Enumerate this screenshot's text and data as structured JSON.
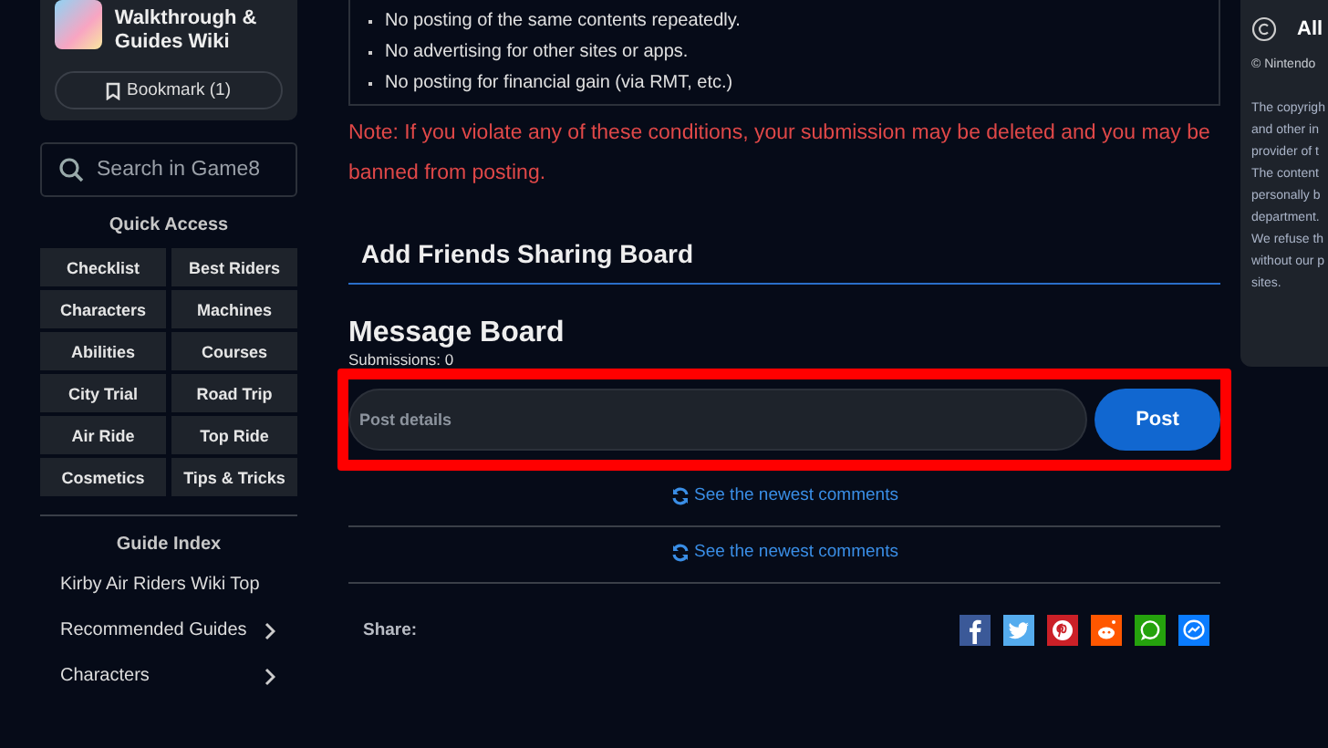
{
  "sidebar": {
    "wiki_title": "Walkthrough & Guides Wiki",
    "bookmark": "Bookmark (1)",
    "search": {
      "placeholder": "Search in Game8"
    },
    "quick_access": {
      "heading": "Quick Access",
      "links": [
        "Checklist",
        "Best Riders",
        "Characters",
        "Machines",
        "Abilities",
        "Courses",
        "City Trial",
        "Road Trip",
        "Air Ride",
        "Top Ride",
        "Cosmetics",
        "Tips & Tricks"
      ]
    },
    "guide_index": {
      "heading": "Guide Index",
      "items": [
        {
          "label": "Kirby Air Riders Wiki Top",
          "has_submenu": false
        },
        {
          "label": "Recommended Guides",
          "has_submenu": true
        },
        {
          "label": "Characters",
          "has_submenu": true
        }
      ]
    }
  },
  "main": {
    "rules": [
      "No posting of the same contents repeatedly.",
      "No advertising for other sites or apps.",
      "No posting for financial gain (via RMT, etc.)"
    ],
    "note": "Note: If you violate any of these conditions, your submission may be deleted and you may be banned from posting.",
    "section_heading": "Add Friends Sharing Board",
    "board_title": "Message Board",
    "submissions": "Submissions: 0",
    "composer": {
      "highlighted": true,
      "placeholder": "Post details",
      "button": "Post"
    },
    "newest_links": [
      "See the newest comments",
      "See the newest comments"
    ],
    "share": {
      "label": "Share:",
      "networks": [
        {
          "kind": "facebook",
          "color": "#3b5998"
        },
        {
          "kind": "twitter",
          "color": "#55acee"
        },
        {
          "kind": "pinterest",
          "color": "#cb2027"
        },
        {
          "kind": "reddit",
          "color": "#ff5700"
        },
        {
          "kind": "whatsapp",
          "color": "#25a20d"
        },
        {
          "kind": "messenger",
          "color": "#0a7cff"
        }
      ]
    }
  },
  "right_panel": {
    "title": "All",
    "lines": [
      "© Nintendo",
      "The copyrigh",
      "and other in",
      "provider of t",
      "The content",
      "personally b",
      "department.",
      "We refuse th",
      "without our p",
      "sites."
    ]
  }
}
